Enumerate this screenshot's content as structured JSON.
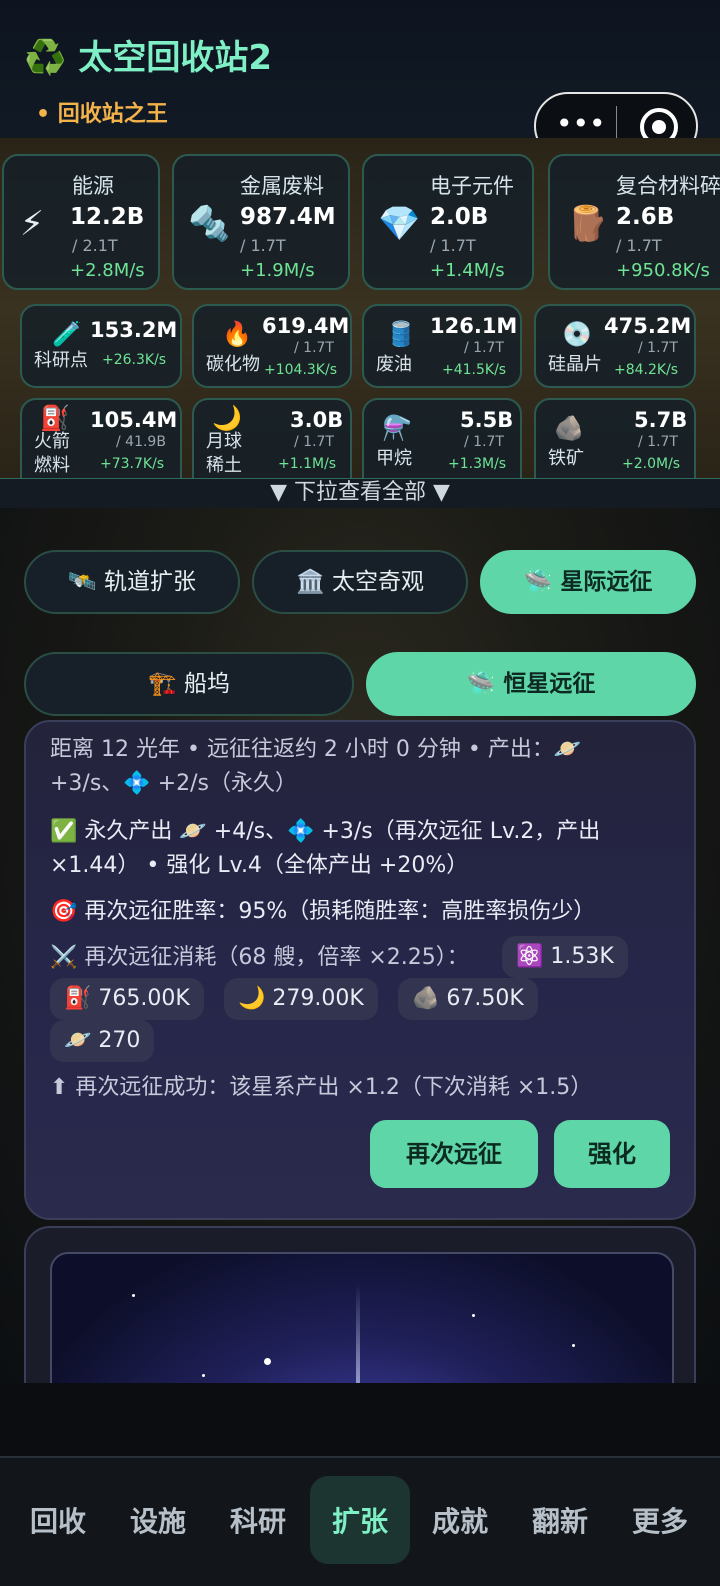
{
  "header": {
    "title": "太空回收站2",
    "title_icon": "♻️",
    "subtitle": "• 回收站之王",
    "capsule_dots": "•••"
  },
  "resources_large": [
    {
      "name": "能源",
      "icon": "⚡",
      "amount": "12.2B",
      "cap": "/ 2.1T",
      "rate": "+2.8M/s"
    },
    {
      "name": "金属废料",
      "icon": "🔩",
      "amount": "987.4M",
      "cap": "/ 1.7T",
      "rate": "+1.9M/s"
    },
    {
      "name": "电子元件",
      "icon": "💎",
      "amount": "2.0B",
      "cap": "/ 1.7T",
      "rate": "+1.4M/s"
    },
    {
      "name": "复合材料碎",
      "icon": "🪵",
      "amount": "2.6B",
      "cap": "/ 1.7T",
      "rate": "+950.8K/s"
    }
  ],
  "resources_small_row1": [
    {
      "name": "科研点",
      "icon": "🧪",
      "amount": "153.2M",
      "cap": "",
      "rate": "+26.3K/s"
    },
    {
      "name": "碳化物",
      "icon": "🔥",
      "amount": "619.4M",
      "cap": "/ 1.7T",
      "rate": "+104.3K/s"
    },
    {
      "name": "废油",
      "icon": "🛢️",
      "amount": "126.1M",
      "cap": "/ 1.7T",
      "rate": "+41.5K/s"
    },
    {
      "name": "硅晶片",
      "icon": "💿",
      "amount": "475.2M",
      "cap": "/ 1.7T",
      "rate": "+84.2K/s"
    }
  ],
  "resources_small_row2": [
    {
      "name": "火箭燃料",
      "icon": "⛽",
      "amount": "105.4M",
      "cap": "/ 41.9B",
      "rate": "+73.7K/s"
    },
    {
      "name": "月球稀土",
      "icon": "🌙",
      "amount": "3.0B",
      "cap": "/ 1.7T",
      "rate": "+1.1M/s"
    },
    {
      "name": "甲烷",
      "icon": "⚗️",
      "amount": "5.5B",
      "cap": "/ 1.7T",
      "rate": "+1.3M/s"
    },
    {
      "name": "铁矿",
      "icon": "🪨",
      "amount": "5.7B",
      "cap": "/ 1.7T",
      "rate": "+2.0M/s"
    }
  ],
  "pull_hint": "▼ 下拉查看全部 ▼",
  "tabs_top": [
    {
      "label": "🛰️ 轨道扩张"
    },
    {
      "label": "🏛️ 太空奇观"
    },
    {
      "label": "🛸 星际远征"
    }
  ],
  "tabs_sub": [
    {
      "label": "🏗️ 船坞"
    },
    {
      "label": "🛸 恒星远征"
    }
  ],
  "expedition": {
    "line1a": "距离 12 光年 • 远征往返约 2 小时 0 分钟 • 产出：🪐",
    "line1b": "+3/s、💠 +2/s（永久）",
    "line2a": "✅ 永久产出 🪐 +4/s、💠 +3/s（再次远征 Lv.2，产出",
    "line2b": "×1.44） • 强化 Lv.4（全体产出 +20%）",
    "line3": "🎯 再次远征胜率：95%（损耗随胜率：高胜率损伤少）",
    "line4": "⚔️ 再次远征消耗（68 艘，倍率 ×2.25）：",
    "costs": [
      "⚛️ 1.53K",
      "⛽ 765.00K",
      "🌙 279.00K",
      "🪨 67.50K",
      "🪐 270"
    ],
    "line5": "⬆ 再次远征成功：该星系产出 ×1.2（下次消耗 ×1.5）",
    "btn_again": "再次远征",
    "btn_upgrade": "强化"
  },
  "nav": [
    {
      "label": "回收"
    },
    {
      "label": "设施"
    },
    {
      "label": "科研"
    },
    {
      "label": "扩张"
    },
    {
      "label": "成就"
    },
    {
      "label": "翻新"
    },
    {
      "label": "更多"
    }
  ],
  "colors": {
    "accent": "#5fd6a7",
    "title": "#7ff0c5",
    "subtitle": "#f3b24a",
    "rate": "#6ee394"
  }
}
